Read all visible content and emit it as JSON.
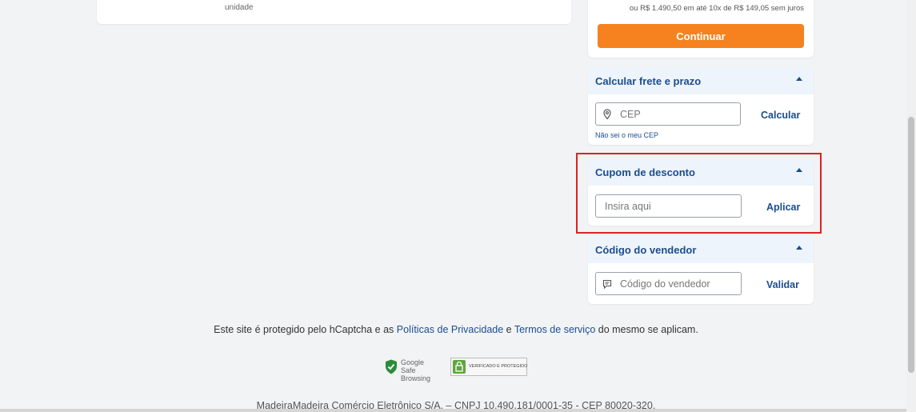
{
  "product": {
    "unit_label": "unidade"
  },
  "summary": {
    "installments_text": "ou R$ 1.490,50 em até 10x de R$ 149,05 sem juros",
    "continue_label": "Continuar"
  },
  "shipping": {
    "title": "Calcular frete e prazo",
    "placeholder": "CEP",
    "action_label": "Calcular",
    "helper_link": "Não sei o meu CEP"
  },
  "coupon": {
    "title": "Cupom de desconto",
    "placeholder": "Insira aqui",
    "action_label": "Aplicar"
  },
  "seller": {
    "title": "Código do vendedor",
    "placeholder": "Código do vendedor",
    "action_label": "Validar"
  },
  "footer": {
    "captcha_prefix": "Este site é protegido pelo hCaptcha e as ",
    "privacy_link": "Políticas de Privacidade",
    "conjunction": " e ",
    "terms_link": "Termos de serviço",
    "captcha_suffix": " do mesmo se aplicam.",
    "google_badge_line1": "Google",
    "google_badge_line2": "Safe Browsing",
    "secure_badge_text": "VERIFICADO E PROTEGIDO",
    "company_text": "MadeiraMadeira Comércio Eletrônico S/A. – CNPJ 10.490.181/0001-35 - CEP 80020-320."
  },
  "colors": {
    "accent_orange": "#f5821f",
    "link_blue": "#1b4d8f",
    "highlight_red": "#e02020"
  }
}
